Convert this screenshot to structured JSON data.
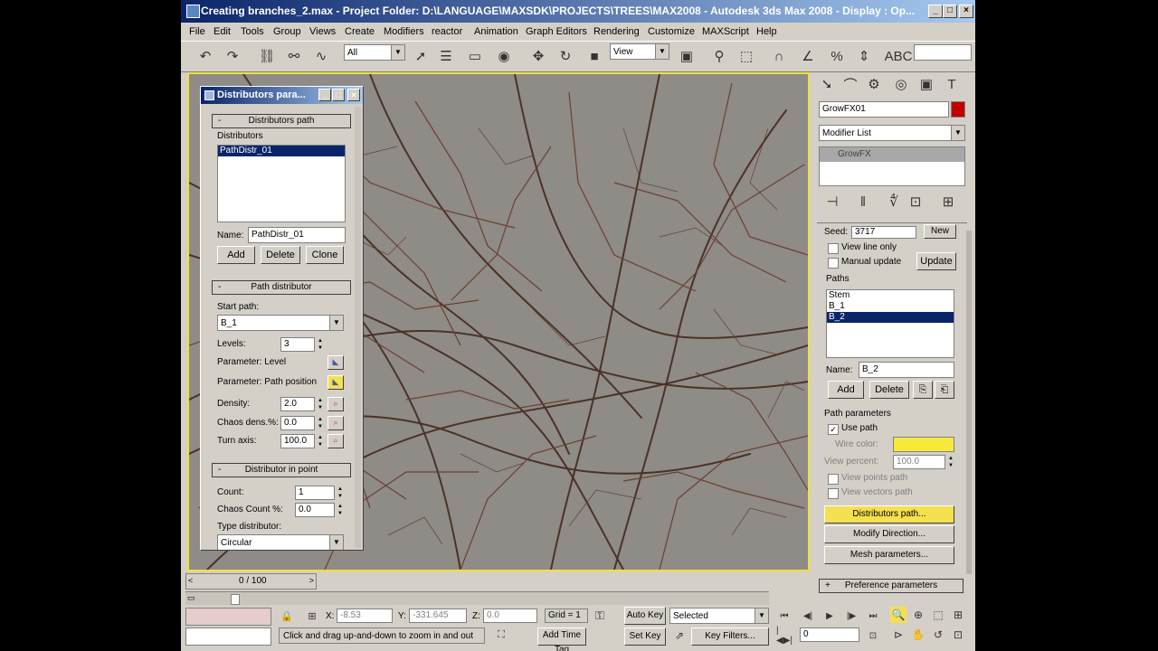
{
  "window": {
    "title": "Creating branches_2.max - Project Folder: D:\\LANGUAGE\\MAXSDK\\PROJECTS\\TREES\\MAX2008 - Autodesk 3ds Max 2008 - Display : Op..."
  },
  "menu": [
    "File",
    "Edit",
    "Tools",
    "Group",
    "Views",
    "Create",
    "Modifiers",
    "reactor",
    "Animation",
    "Graph Editors",
    "Rendering",
    "Customize",
    "MAXScript",
    "Help"
  ],
  "toolbar": {
    "selection_filter": "All",
    "ref_coord": "View"
  },
  "dialog": {
    "title": "Distributors para...",
    "rollout_path": "Distributors path",
    "distributors_label": "Distributors",
    "distributors": [
      "PathDistr_01"
    ],
    "name_label": "Name:",
    "name_value": "PathDistr_01",
    "add": "Add",
    "delete": "Delete",
    "clone": "Clone",
    "rollout_path_distributor": "Path distributor",
    "start_path_label": "Start path:",
    "start_path_value": "B_1",
    "levels_label": "Levels:",
    "levels_value": "3",
    "param_level": "Parameter: Level",
    "param_path_position": "Parameter: Path position",
    "density_label": "Density:",
    "density_value": "2.0",
    "chaos_dens_label": "Chaos dens.%:",
    "chaos_dens_value": "0.0",
    "turn_axis_label": "Turn axis:",
    "turn_axis_value": "100.0",
    "rollout_distributor_in_point": "Distributor in point",
    "count_label": "Count:",
    "count_value": "1",
    "chaos_count_label": "Chaos Count %:",
    "chaos_count_value": "0.0",
    "type_distributor_label": "Type distributor:",
    "type_distributor_value": "Circular"
  },
  "command_panel": {
    "object_name": "GrowFX01",
    "object_color": "#c00000",
    "modifier_list": "Modifier List",
    "stack_item": "GrowFX",
    "seed_label": "Seed:",
    "seed_value": "3717",
    "new": "New",
    "view_line_only": "View line only",
    "manual_update": "Manual update",
    "update": "Update",
    "paths_label": "Paths",
    "paths": [
      "Stem",
      "B_1",
      "B_2"
    ],
    "name_label": "Name:",
    "name_value": "B_2",
    "add": "Add",
    "delete": "Delete",
    "path_parameters_label": "Path parameters",
    "use_path": "Use path",
    "wire_color_label": "Wire color:",
    "wire_color": "#f5ea3c",
    "view_percent_label": "View percent:",
    "view_percent_value": "100.0",
    "view_points_path": "View points path",
    "view_vectors_path": "View vectors path",
    "distributors_path_btn": "Distributors path...",
    "modify_direction_btn": "Modify Direction...",
    "mesh_parameters_btn": "Mesh parameters...",
    "preference_rollout": "Preference parameters"
  },
  "timeline": {
    "frame_label": "0 / 100"
  },
  "status": {
    "x_label": "X:",
    "x_value": "-8.53",
    "y_label": "Y:",
    "y_value": "-331.645",
    "z_label": "Z:",
    "z_value": "0.0",
    "grid": "Grid = 1",
    "auto_key": "Auto Key",
    "selected": "Selected",
    "set_key": "Set Key",
    "key_filters": "Key Filters...",
    "prompt": "Click and drag up-and-down to zoom in and out",
    "add_time_tag": "Add Time Tag",
    "frame_value": "0"
  }
}
